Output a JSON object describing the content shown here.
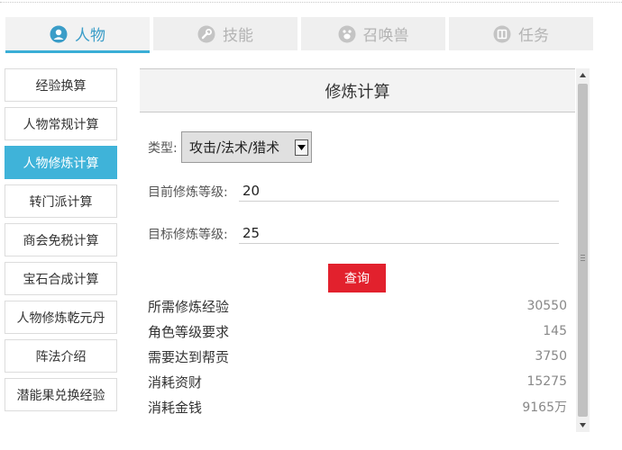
{
  "tabs": [
    {
      "label": "人物",
      "icon": "person-icon",
      "active": true
    },
    {
      "label": "技能",
      "icon": "wrench-icon",
      "active": false
    },
    {
      "label": "召唤兽",
      "icon": "pet-icon",
      "active": false
    },
    {
      "label": "任务",
      "icon": "book-icon",
      "active": false
    }
  ],
  "sidebar": {
    "items": [
      {
        "label": "经验换算"
      },
      {
        "label": "人物常规计算"
      },
      {
        "label": "人物修炼计算",
        "active": true
      },
      {
        "label": "转门派计算"
      },
      {
        "label": "商会免税计算"
      },
      {
        "label": "宝石合成计算"
      },
      {
        "label": "人物修炼乾元丹"
      },
      {
        "label": "阵法介绍"
      },
      {
        "label": "潜能果兑换经验"
      }
    ]
  },
  "panel": {
    "title": "修炼计算",
    "type_label": "类型:",
    "type_value": "攻击/法术/猎术",
    "current_label": "目前修炼等级:",
    "current_value": "20",
    "target_label": "目标修炼等级:",
    "target_value": "25",
    "query_label": "查询",
    "results": [
      {
        "label": "所需修炼经验",
        "value": "30550"
      },
      {
        "label": "角色等级要求",
        "value": "145"
      },
      {
        "label": "需要达到帮贡",
        "value": "3750"
      },
      {
        "label": "消耗资财",
        "value": "15275"
      },
      {
        "label": "消耗金钱",
        "value": "9165万"
      }
    ]
  },
  "colors": {
    "accent": "#3fb3d9",
    "tab_active_text": "#3b9dc8",
    "query_button": "#e2212d"
  }
}
